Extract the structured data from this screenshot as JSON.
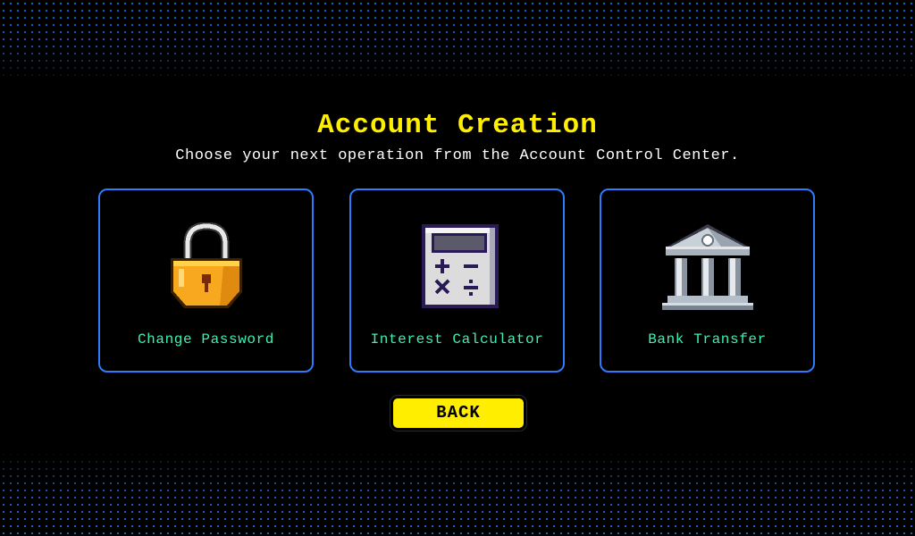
{
  "header": {
    "title": "Account Creation",
    "subtitle": "Choose your next operation from the Account Control Center."
  },
  "cards": [
    {
      "label": "Change Password",
      "icon": "padlock-icon"
    },
    {
      "label": "Interest Calculator",
      "icon": "calculator-icon"
    },
    {
      "label": "Bank Transfer",
      "icon": "bank-icon"
    }
  ],
  "back_button": {
    "label": "BACK"
  },
  "colors": {
    "background": "#000000",
    "title": "#ffee00",
    "subtitle": "#ffffff",
    "card_border": "#2e7bff",
    "card_label": "#3ef0b6",
    "back_button_bg": "#ffee00",
    "dot_pattern": "#1b6fd6"
  }
}
